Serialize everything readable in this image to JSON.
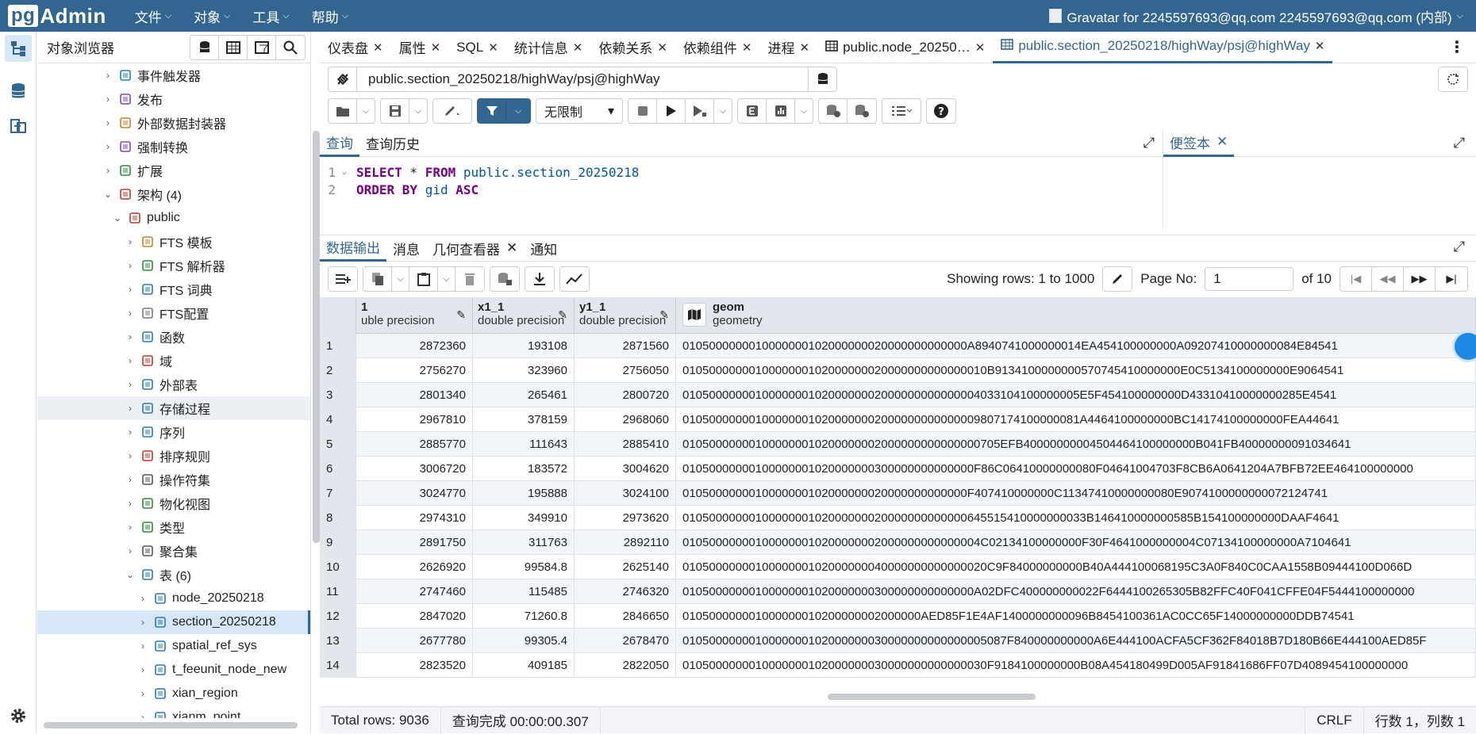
{
  "app": {
    "logo_pg": "pg",
    "logo_text": "Admin",
    "menus": [
      "文件",
      "对象",
      "工具",
      "帮助"
    ],
    "user": "Gravatar for 2245597693@qq.com 2245597693@qq.com (内部)"
  },
  "browser": {
    "title": "对象浏览器",
    "tree": [
      {
        "label": "事件触发器",
        "icon": "event-trigger-icon"
      },
      {
        "label": "发布",
        "icon": "publication-icon"
      },
      {
        "label": "外部数据封装器",
        "icon": "foreign-data-wrapper-icon"
      },
      {
        "label": "强制转换",
        "icon": "cast-icon"
      },
      {
        "label": "扩展",
        "icon": "extension-icon"
      },
      {
        "label": "架构 (4)",
        "icon": "schema-icon"
      },
      {
        "label": "public",
        "icon": "public-schema-icon"
      },
      {
        "label": "FTS 模板",
        "icon": "fts-template-icon"
      },
      {
        "label": "FTS 解析器",
        "icon": "fts-parser-icon"
      },
      {
        "label": "FTS 词典",
        "icon": "fts-dictionary-icon"
      },
      {
        "label": "FTS配置",
        "icon": "fts-config-icon"
      },
      {
        "label": "函数",
        "icon": "function-icon"
      },
      {
        "label": "域",
        "icon": "domain-icon"
      },
      {
        "label": "外部表",
        "icon": "foreign-table-icon"
      },
      {
        "label": "存储过程",
        "icon": "procedure-icon"
      },
      {
        "label": "序列",
        "icon": "sequence-icon"
      },
      {
        "label": "排序规则",
        "icon": "collation-icon"
      },
      {
        "label": "操作符集",
        "icon": "operator-icon"
      },
      {
        "label": "物化视图",
        "icon": "mview-icon"
      },
      {
        "label": "类型",
        "icon": "type-icon"
      },
      {
        "label": "聚合集",
        "icon": "aggregate-icon"
      },
      {
        "label": "表 (6)",
        "icon": "tables-icon"
      },
      {
        "label": "node_20250218",
        "icon": "table-icon"
      },
      {
        "label": "section_20250218",
        "icon": "table-icon"
      },
      {
        "label": "spatial_ref_sys",
        "icon": "table-icon"
      },
      {
        "label": "t_feeunit_node_new",
        "icon": "table-icon"
      },
      {
        "label": "xian_region",
        "icon": "table-icon"
      },
      {
        "label": "xianm_point",
        "icon": "table-icon"
      }
    ]
  },
  "tabs": [
    {
      "label": "仪表盘"
    },
    {
      "label": "属性"
    },
    {
      "label": "SQL"
    },
    {
      "label": "统计信息"
    },
    {
      "label": "依赖关系"
    },
    {
      "label": "依赖组件"
    },
    {
      "label": "进程"
    },
    {
      "label": "public.node_20250…"
    },
    {
      "label": "public.section_20250218/highWay/psj@highWay"
    }
  ],
  "connection": "public.section_20250218/highWay/psj@highWay",
  "limit": "无限制",
  "query_tabs": [
    "查询",
    "查询历史"
  ],
  "notes_tab": "便签本",
  "sql": {
    "line1": {
      "n": "1",
      "kw1": "SELECT",
      "mid": " * ",
      "kw2": "FROM",
      "schema": " public.",
      "table": "section_20250218"
    },
    "line2": {
      "n": "2",
      "kw1": "ORDER BY",
      "col": " gid ",
      "kw2": "ASC"
    }
  },
  "output_tabs": [
    "数据输出",
    "消息",
    "几何查看器",
    "通知"
  ],
  "pager": {
    "showing": "Showing rows: 1 to 1000",
    "page_label": "Page No:",
    "page": "1",
    "of": "of 10"
  },
  "grid": {
    "columns": [
      {
        "name": "1",
        "type": "uble precision"
      },
      {
        "name": "x1_1",
        "type": "double precision"
      },
      {
        "name": "y1_1",
        "type": "double precision"
      },
      {
        "name": "geom",
        "type": "geometry"
      }
    ],
    "rows": [
      [
        "1",
        "2872360",
        "193108",
        "2871560",
        "0105000000010000000102000000020000000000000A8940741000000014EA454100000000A09207410000000084E84541"
      ],
      [
        "2",
        "2756270",
        "323960",
        "2756050",
        "0105000000010000000102000000020000000000000010B9134100000000570745410000000E0C5134100000000E9064541"
      ],
      [
        "3",
        "2801340",
        "265461",
        "2800720",
        "010500000001000000010200000002000000000000004033104100000005E5F454100000000D43310410000000285E4541"
      ],
      [
        "4",
        "2967810",
        "378159",
        "2968060",
        "010500000001000000010200000002000000000000009807174100000081A4464100000000BC14174100000000FEA44641"
      ],
      [
        "5",
        "2885770",
        "111643",
        "2885410",
        "010500000001000000010200000002000000000000000705EFB40000000004504464100000000B041FB40000000091034641"
      ],
      [
        "6",
        "3006720",
        "183572",
        "3004620",
        "01050000000100000001020000000300000000000000F86C06410000000080F04641004703F8CB6A0641204A7BFB72EE464100000000"
      ],
      [
        "7",
        "3024770",
        "195888",
        "3024100",
        "0105000000010000000102000000020000000000000F407410000000C11347410000000080E9074100000000072124741"
      ],
      [
        "8",
        "2974310",
        "349910",
        "2973620",
        "0105000000010000000102000000020000000000000645515410000000033B146410000000585B154100000000DAAF4641"
      ],
      [
        "9",
        "2891750",
        "311763",
        "2892110",
        "010500000001000000010200000002000000000000004C02134100000000F30F4641000000004C07134100000000A7104641"
      ],
      [
        "10",
        "2626920",
        "99584.8",
        "2625140",
        "0105000000010000000102000000040000000000000020C9F84000000000B40A444100068195C3A0F840C0CAA1558B09444100D066D"
      ],
      [
        "11",
        "2747460",
        "115485",
        "2746320",
        "01050000000100000001020000000300000000000000A02DFC400000000022F6444100265305B82FFC40F041CFFE04F5444100000000"
      ],
      [
        "12",
        "2847020",
        "71260.8",
        "2846650",
        "010500000001000000010200000002000000AED85F1E4AF1400000000096B8454100361AC0CC65F14000000000DDB74541"
      ],
      [
        "13",
        "2677780",
        "99305.4",
        "2678470",
        "0105000000010000000102000000030000000000000005087F840000000000A6E444100ACFA5CF362F84018B7D180B66E444100AED85F"
      ],
      [
        "14",
        "2823520",
        "409185",
        "2822050",
        "0105000000010000000102000000030000000000000030F9184100000000B08A454180499D005AF91841686FF07D4089454100000000"
      ]
    ]
  },
  "status": {
    "total": "Total rows: 9036",
    "query": "查询完成 00:00:00.307",
    "eol": "CRLF",
    "pos": "行数 1，列数 1"
  }
}
